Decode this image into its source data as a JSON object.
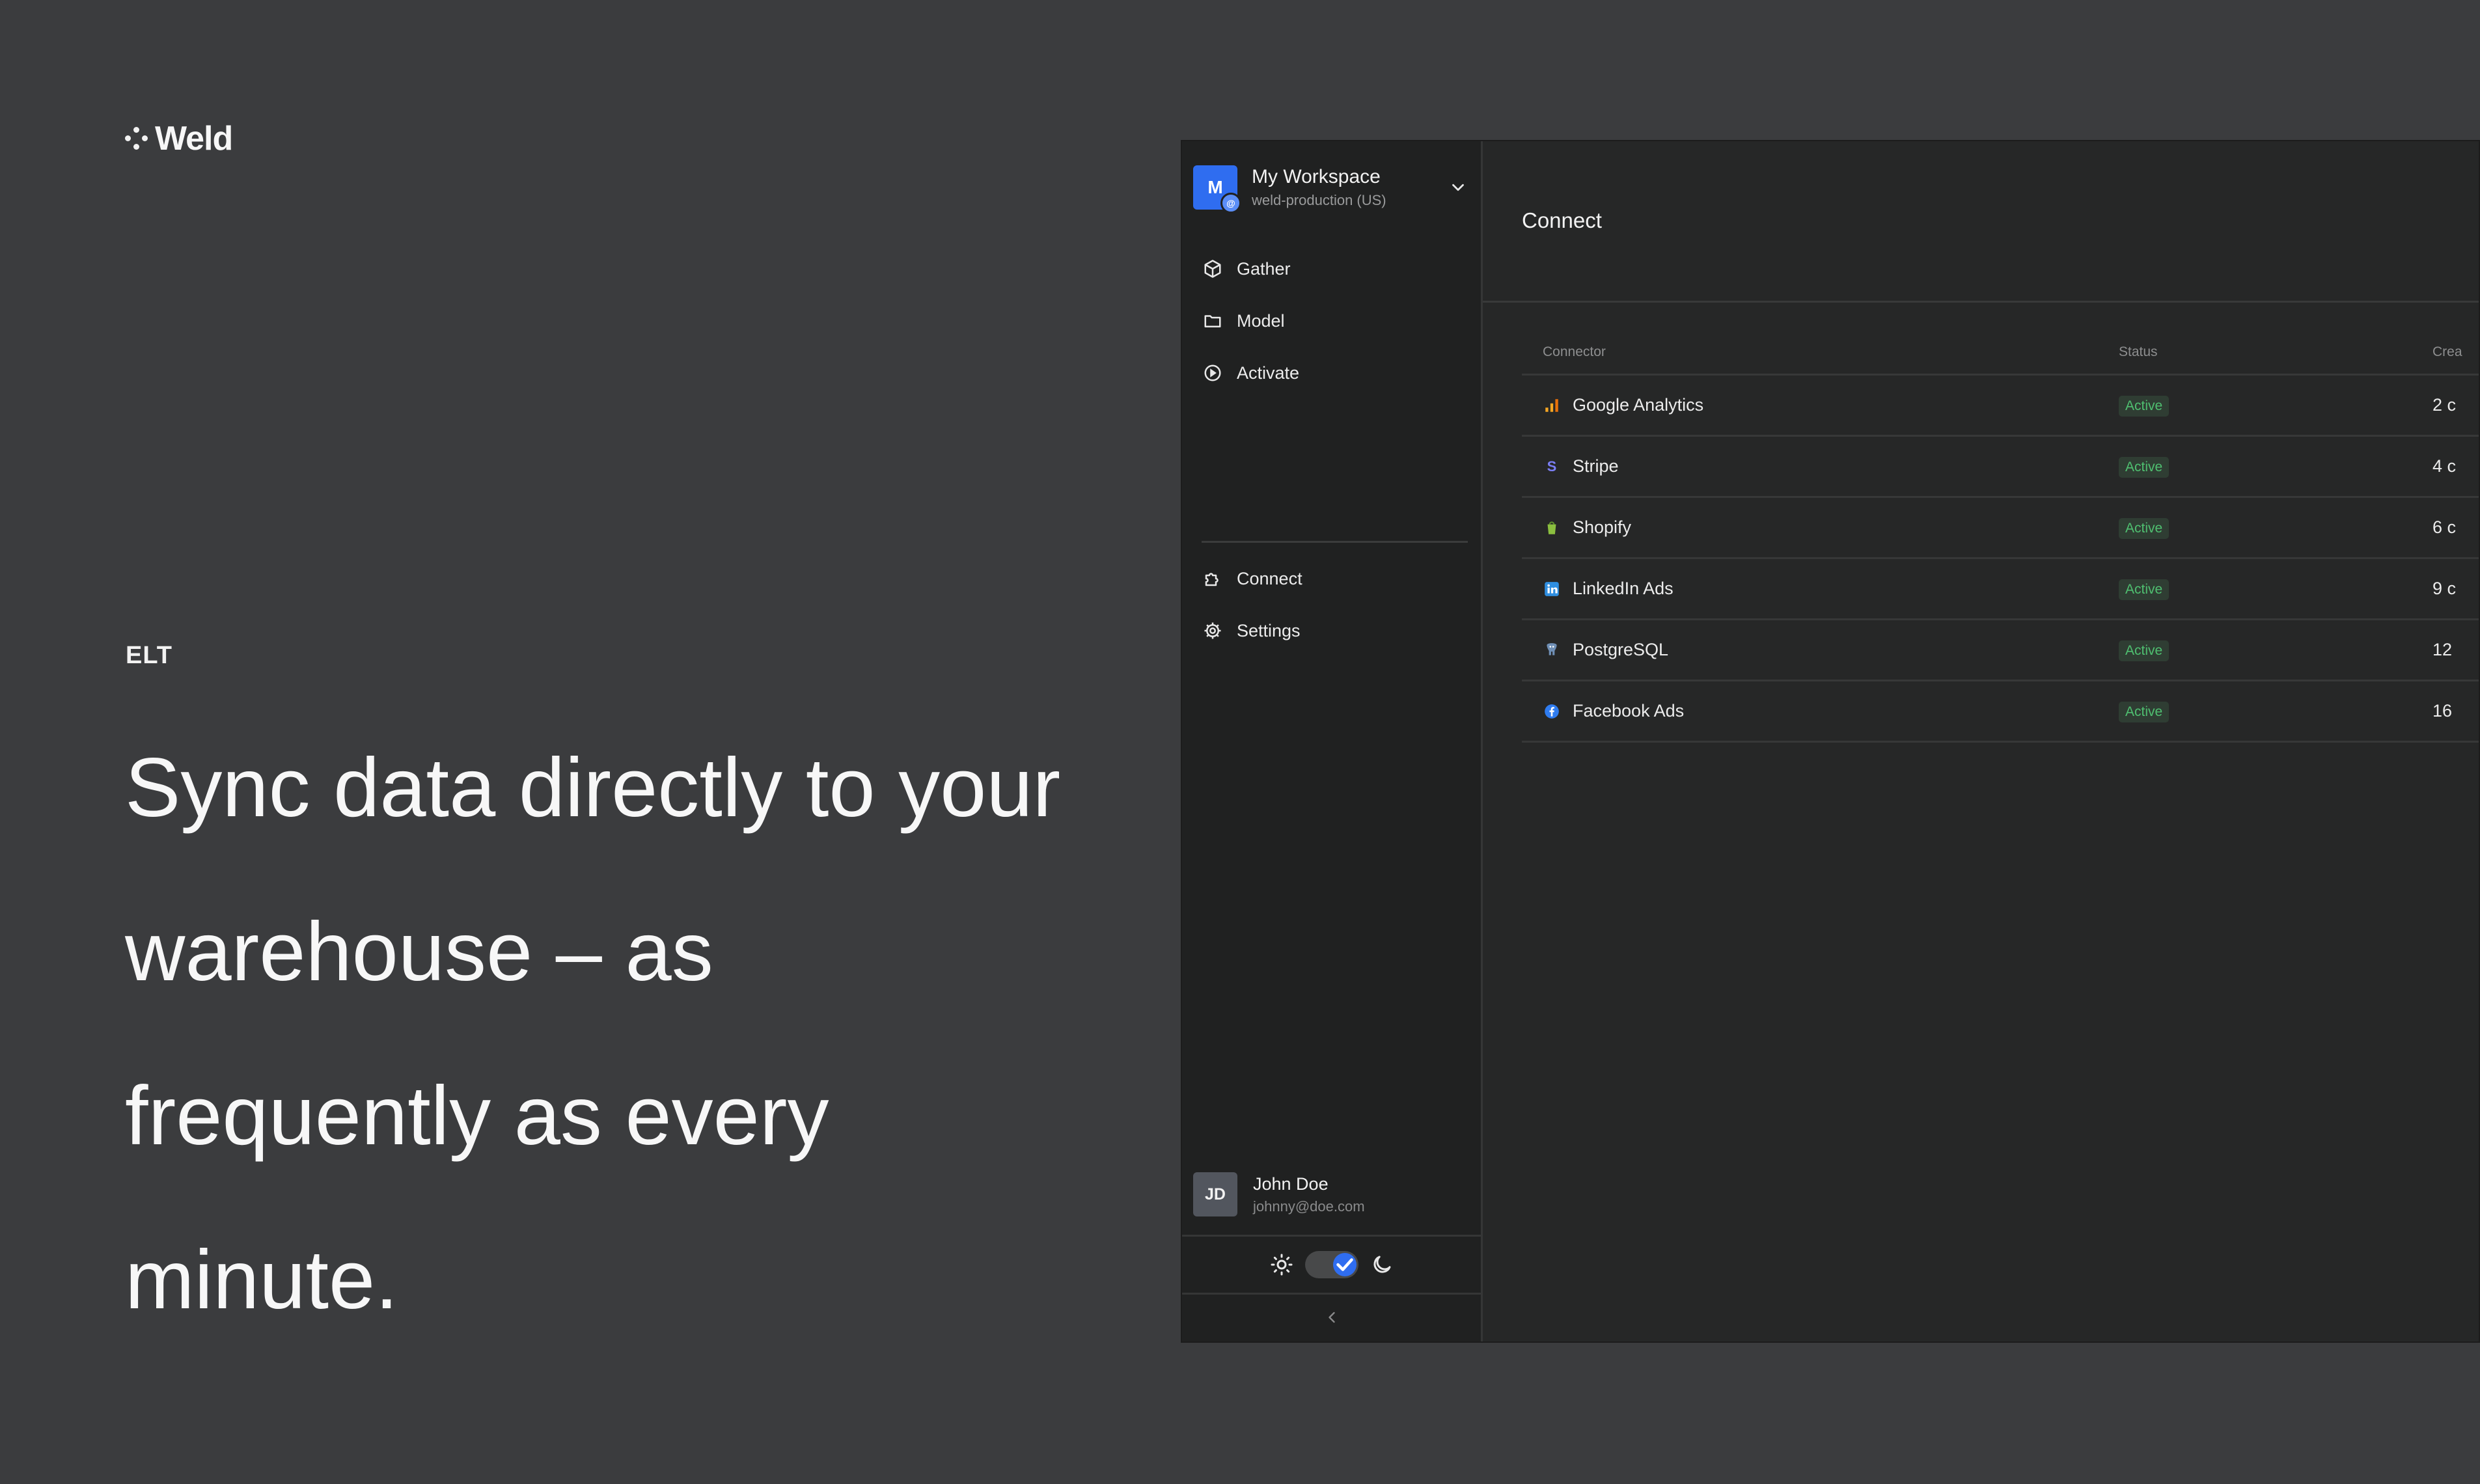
{
  "brand": {
    "name": "Weld"
  },
  "hero": {
    "eyebrow": "ELT",
    "headline": "Sync data directly to your warehouse – as frequently as every minute."
  },
  "workspace": {
    "initial": "M",
    "name": "My Workspace",
    "environment": "weld-production (US)"
  },
  "nav": {
    "primary": [
      {
        "label": "Gather",
        "icon": "cube-icon"
      },
      {
        "label": "Model",
        "icon": "folder-icon"
      },
      {
        "label": "Activate",
        "icon": "play-circle-icon"
      }
    ],
    "secondary": [
      {
        "label": "Connect",
        "icon": "puzzle-icon"
      },
      {
        "label": "Settings",
        "icon": "gear-icon"
      }
    ]
  },
  "user": {
    "initials": "JD",
    "name": "John Doe",
    "email": "johnny@doe.com"
  },
  "theme": {
    "dark_mode": true
  },
  "main": {
    "title": "Connect",
    "columns": [
      "Connector",
      "Status",
      "Crea"
    ],
    "rows": [
      {
        "name": "Google Analytics",
        "status": "Active",
        "created": "2 c",
        "icon": "google-analytics-icon",
        "color": "#f5a623"
      },
      {
        "name": "Stripe",
        "status": "Active",
        "created": "4 c",
        "icon": "stripe-icon",
        "color": "#7b7ff5"
      },
      {
        "name": "Shopify",
        "status": "Active",
        "created": "6 c",
        "icon": "shopify-icon",
        "color": "#8bbf3f"
      },
      {
        "name": "LinkedIn Ads",
        "status": "Active",
        "created": "9 c",
        "icon": "linkedin-icon",
        "color": "#2f8ee0"
      },
      {
        "name": "PostgreSQL",
        "status": "Active",
        "created": "12",
        "icon": "postgresql-icon",
        "color": "#6f8fb5"
      },
      {
        "name": "Facebook Ads",
        "status": "Active",
        "created": "16",
        "icon": "facebook-icon",
        "color": "#2f7cf0"
      }
    ]
  },
  "colors": {
    "accent": "#2f6df0",
    "status_active": "#4fbf70"
  }
}
